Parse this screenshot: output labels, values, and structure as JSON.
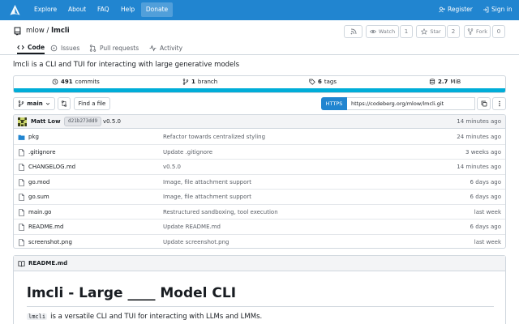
{
  "topnav": {
    "logo_icon": "codeberg-logo",
    "items": [
      "Explore",
      "About",
      "FAQ",
      "Help"
    ],
    "donate": "Donate",
    "register": "Register",
    "signin": "Sign in"
  },
  "repo": {
    "owner": "mlow",
    "separator": "/",
    "name": "lmcli",
    "rss_icon": "rss-icon",
    "watch_label": "Watch",
    "watch_count": "1",
    "star_label": "Star",
    "star_count": "2",
    "fork_label": "Fork",
    "fork_count": "0"
  },
  "tabs": [
    {
      "label": "Code",
      "icon": "code-icon",
      "active": true
    },
    {
      "label": "Issues",
      "icon": "issue-icon",
      "active": false
    },
    {
      "label": "Pull requests",
      "icon": "pull-request-icon",
      "active": false
    },
    {
      "label": "Activity",
      "icon": "pulse-icon",
      "active": false
    }
  ],
  "description": "lmcli is a CLI and TUI for interacting with large generative models",
  "stats": {
    "commits_count": "491",
    "commits_label": "commits",
    "branches_count": "1",
    "branches_label": "branch",
    "tags_count": "6",
    "tags_label": "tags",
    "size_value": "2.7",
    "size_unit": "MiB",
    "language_bar_color": "#00add8"
  },
  "branch_bar": {
    "branch": "main",
    "find_file": "Find a file",
    "https_label": "HTTPS",
    "clone_url": "https://codeberg.org/mlow/lmcli.git"
  },
  "latest_commit": {
    "author": "Matt Low",
    "sha": "d21b273dd9",
    "message": "v0.5.0",
    "time": "14 minutes ago"
  },
  "files": [
    {
      "name": "pkg",
      "type": "folder",
      "message": "Refactor towards centralized styling",
      "time": "24 minutes ago"
    },
    {
      "name": ".gitignore",
      "type": "file",
      "message": "Update .gitignore",
      "time": "3 weeks ago"
    },
    {
      "name": "CHANGELOG.md",
      "type": "file",
      "message": "v0.5.0",
      "time": "14 minutes ago"
    },
    {
      "name": "go.mod",
      "type": "file",
      "message": "Image, file attachment support",
      "time": "6 days ago"
    },
    {
      "name": "go.sum",
      "type": "file",
      "message": "Image, file attachment support",
      "time": "6 days ago"
    },
    {
      "name": "main.go",
      "type": "file",
      "message": "Restructured sandboxing, tool execution",
      "time": "last week"
    },
    {
      "name": "README.md",
      "type": "file",
      "message": "Update README.md",
      "time": "6 days ago"
    },
    {
      "name": "screenshot.png",
      "type": "file",
      "message": "Update screenshot.png",
      "time": "last week"
    }
  ],
  "readme": {
    "filename": "README.md",
    "heading": "lmcli - Large ____ Model CLI",
    "code": "lmcli",
    "text": "is a versatile CLI and TUI for interacting with LLMs and LMMs."
  },
  "colors": {
    "accent": "#2185d0",
    "folder": "#2185d0"
  }
}
